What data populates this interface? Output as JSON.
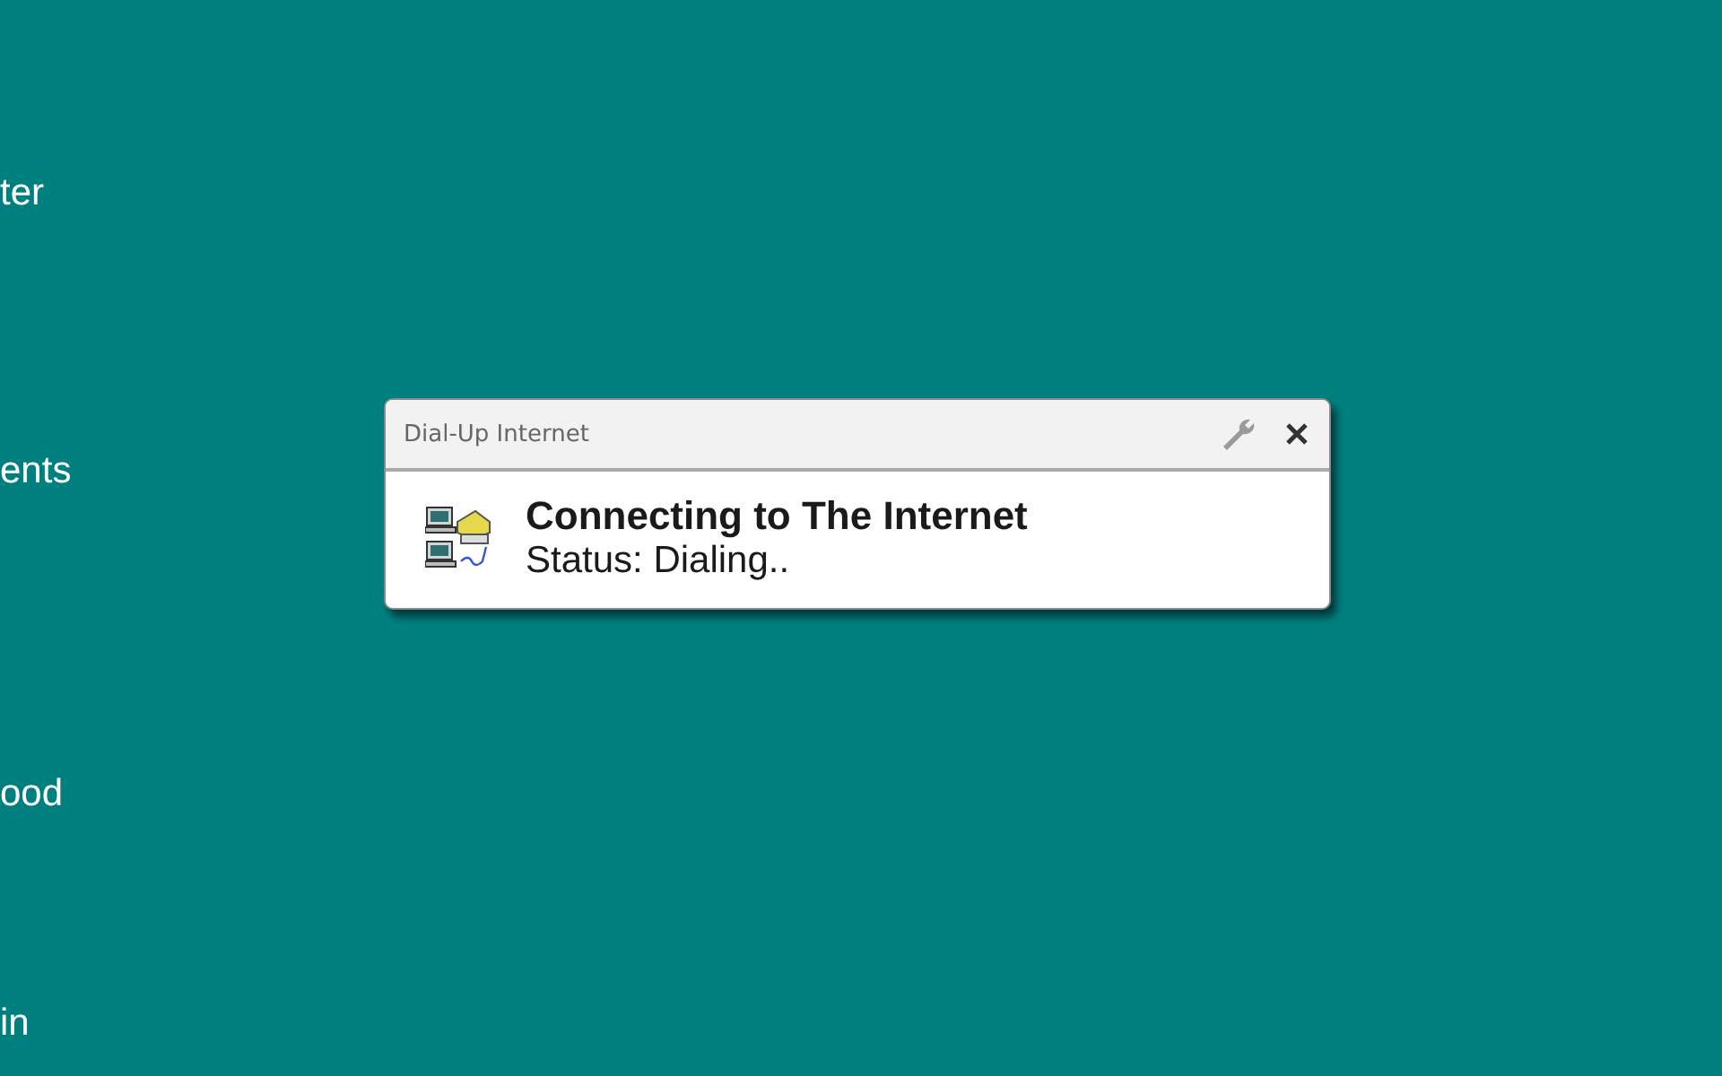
{
  "desktop_icons": [
    {
      "label": "ter"
    },
    {
      "label": "ents"
    },
    {
      "label": "ood"
    },
    {
      "label": "in"
    }
  ],
  "notification": {
    "title": "Dial-Up Internet",
    "heading": "Connecting to The Internet",
    "status": "Status: Dialing.."
  }
}
